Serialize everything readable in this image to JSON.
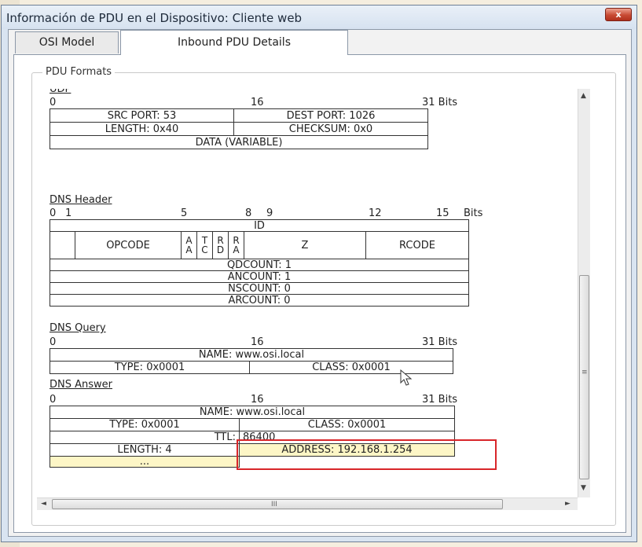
{
  "window": {
    "title": "Información de PDU en el Dispositivo: Cliente web",
    "close_label": "x"
  },
  "tabs": [
    {
      "label": "OSI Model",
      "active": false
    },
    {
      "label": "Inbound PDU Details",
      "active": true
    }
  ],
  "group_title": "PDU Formats",
  "udp": {
    "heading": "UDP",
    "ruler": {
      "start": "0",
      "mid": "16",
      "end": "31 Bits"
    },
    "src_port": "SRC PORT: 53",
    "dest_port": "DEST PORT: 1026",
    "length": "LENGTH: 0x40",
    "checksum": "CHECKSUM: 0x0",
    "data": "DATA (VARIABLE)"
  },
  "dns_header": {
    "heading": "DNS Header",
    "ruler": {
      "b0": "0",
      "b1": "1",
      "b5": "5",
      "b8": "8",
      "b9": "9",
      "b12": "12",
      "b15": "15",
      "unit": "Bits"
    },
    "id": "ID",
    "opcode": "OPCODE",
    "flags": {
      "aa_1": "A",
      "aa_2": "A",
      "tc_1": "T",
      "tc_2": "C",
      "rd_1": "R",
      "rd_2": "D",
      "ra_1": "R",
      "ra_2": "A"
    },
    "z": "Z",
    "rcode": "RCODE",
    "qdcount": "QDCOUNT: 1",
    "ancount": "ANCOUNT: 1",
    "nscount": "NSCOUNT: 0",
    "arcount": "ARCOUNT: 0"
  },
  "dns_query": {
    "heading": "DNS Query",
    "ruler": {
      "start": "0",
      "mid": "16",
      "end": "31 Bits"
    },
    "name": "NAME: www.osi.local",
    "type": "TYPE: 0x0001",
    "class": "CLASS: 0x0001"
  },
  "dns_answer": {
    "heading": "DNS Answer",
    "ruler": {
      "start": "0",
      "mid": "16",
      "end": "31 Bits"
    },
    "name": "NAME: www.osi.local",
    "type": "TYPE: 0x0001",
    "class": "CLASS: 0x0001",
    "ttl_label": "TTL:",
    "ttl_value": "86400",
    "length": "LENGTH: 4",
    "address": "ADDRESS: 192.168.1.254",
    "more": "..."
  },
  "scrollbar": {
    "grip": "≡",
    "hgrip": "III",
    "up": "▲",
    "down": "▼",
    "left": "◄",
    "right": "►"
  },
  "colors": {
    "highlight": "#d8262a",
    "yellow": "#fdf6c6"
  }
}
